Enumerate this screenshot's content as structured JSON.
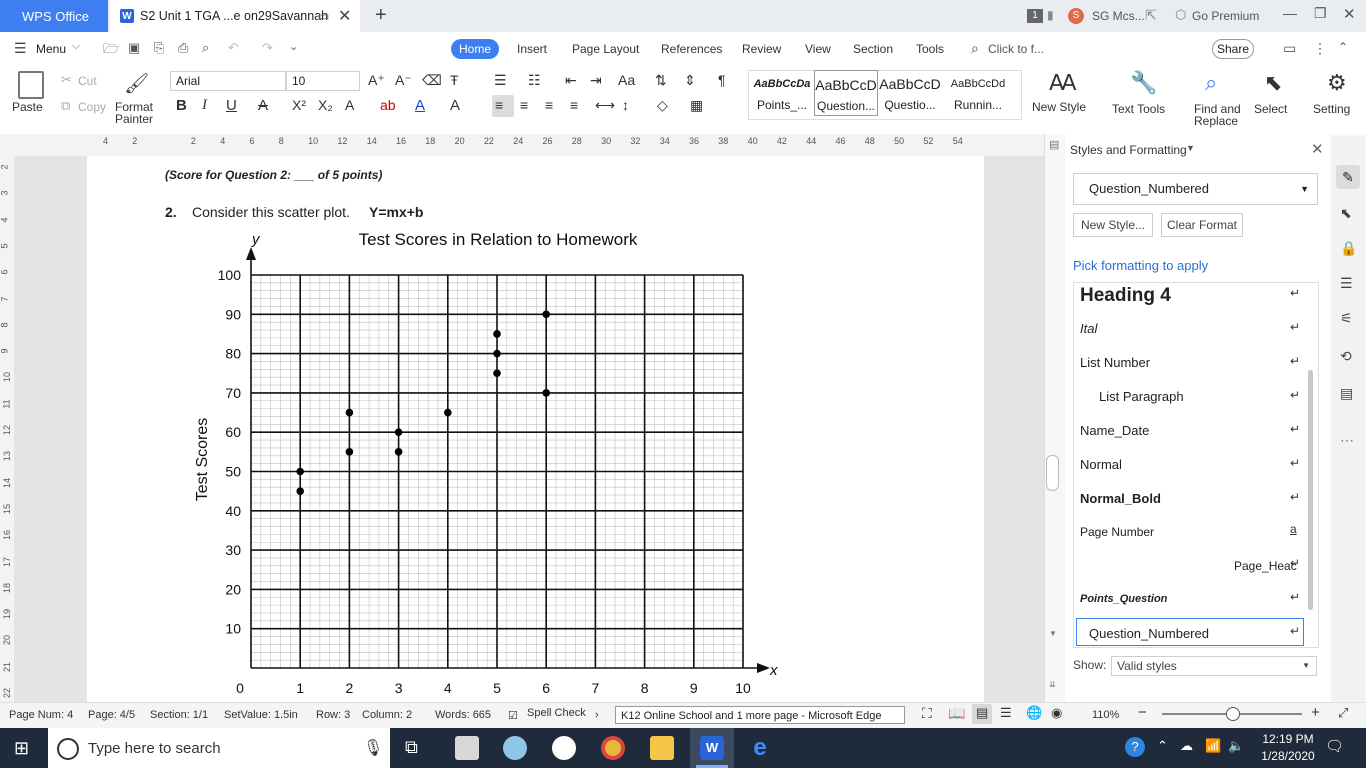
{
  "window": {
    "app_tab": "WPS Office",
    "doc_tab": "S2 Unit 1 TGA ...e on29Savannah",
    "new_tab": "+",
    "count_badge": "1",
    "user": "SG Mcs...",
    "premium": "Go Premium"
  },
  "menu": {
    "menu": "Menu",
    "tabs": [
      "Home",
      "Insert",
      "Page Layout",
      "References",
      "Review",
      "View",
      "Section",
      "Tools"
    ],
    "search": "Click to f...",
    "share": "Share"
  },
  "ribbon": {
    "paste": "Paste",
    "cut": "Cut",
    "copy": "Copy",
    "format_painter_1": "Format",
    "format_painter_2": "Painter",
    "font": "Arial",
    "size": "10",
    "styles": [
      {
        "preview": "AaBbCcDa",
        "name": "Points_..."
      },
      {
        "preview": "AaBbCcD",
        "name": "Question..."
      },
      {
        "preview": "AaBbCcD",
        "name": "Questio..."
      },
      {
        "preview": "AaBbCcDd",
        "name": "Runnin..."
      }
    ],
    "new_style": "New Style",
    "text_tools": "Text Tools",
    "find_replace_1": "Find and",
    "find_replace_2": "Replace",
    "select": "Select",
    "settings": "Setting"
  },
  "ruler": {
    "ticks": [
      "4",
      "2",
      "",
      "2",
      "4",
      "6",
      "8",
      "10",
      "12",
      "14",
      "16",
      "18",
      "20",
      "22",
      "24",
      "26",
      "28",
      "30",
      "32",
      "34",
      "36",
      "38",
      "40",
      "42",
      "44",
      "46",
      "48",
      "50",
      "52",
      "54"
    ],
    "vticks": [
      "2",
      "3",
      "4",
      "5",
      "6",
      "7",
      "8",
      "9",
      "10",
      "11",
      "12",
      "13",
      "14",
      "15",
      "16",
      "17",
      "18",
      "19",
      "20",
      "21",
      "22"
    ]
  },
  "document": {
    "score_line": "(Score for Question 2: ___ of 5 points)",
    "question_num": "2.",
    "question_text": "Consider this scatter plot.",
    "equation": "Y=mx+b"
  },
  "chart_data": {
    "type": "scatter",
    "title": "Test Scores in Relation to Homework",
    "ylabel": "Test Scores",
    "y_axis_letter": "y",
    "x_axis_letter": "x",
    "xlim": [
      0,
      10
    ],
    "ylim": [
      0,
      100
    ],
    "x_ticks": [
      0,
      1,
      2,
      3,
      4,
      5,
      6,
      7,
      8,
      9,
      10
    ],
    "y_ticks": [
      10,
      20,
      30,
      40,
      50,
      60,
      70,
      80,
      90,
      100
    ],
    "grid": true,
    "points": [
      {
        "x": 1,
        "y": 50
      },
      {
        "x": 1,
        "y": 45
      },
      {
        "x": 2,
        "y": 65
      },
      {
        "x": 2,
        "y": 55
      },
      {
        "x": 3,
        "y": 60
      },
      {
        "x": 3,
        "y": 55
      },
      {
        "x": 4,
        "y": 65
      },
      {
        "x": 5,
        "y": 85
      },
      {
        "x": 5,
        "y": 80
      },
      {
        "x": 5,
        "y": 75
      },
      {
        "x": 6,
        "y": 90
      },
      {
        "x": 6,
        "y": 70
      }
    ]
  },
  "side_pane": {
    "title": "Styles and Formatting",
    "current_style": "Question_Numbered",
    "new_style_btn": "New Style...",
    "clear_format_btn": "Clear Format",
    "pick_label": "Pick formatting to apply",
    "styles": [
      "Heading 4",
      "Ital",
      "List Number",
      "List Paragraph",
      "Name_Date",
      "Normal",
      "Normal_Bold",
      "Page Number",
      "Page_Heac",
      "Points_Question",
      "Question_Numbered"
    ],
    "show_label": "Show:",
    "show_value": "Valid styles"
  },
  "status": {
    "page_num": "Page Num: 4",
    "page": "Page: 4/5",
    "section": "Section: 1/1",
    "setvalue": "SetValue: 1.5in",
    "row": "Row: 3",
    "column": "Column: 2",
    "words": "Words: 665",
    "spell": "Spell Check",
    "tooltip": "K12 Online School and 1 more page - Microsoft Edge",
    "zoom": "110%"
  },
  "taskbar": {
    "search_placeholder": "Type here to search",
    "time": "12:19 PM",
    "date": "1/28/2020"
  }
}
